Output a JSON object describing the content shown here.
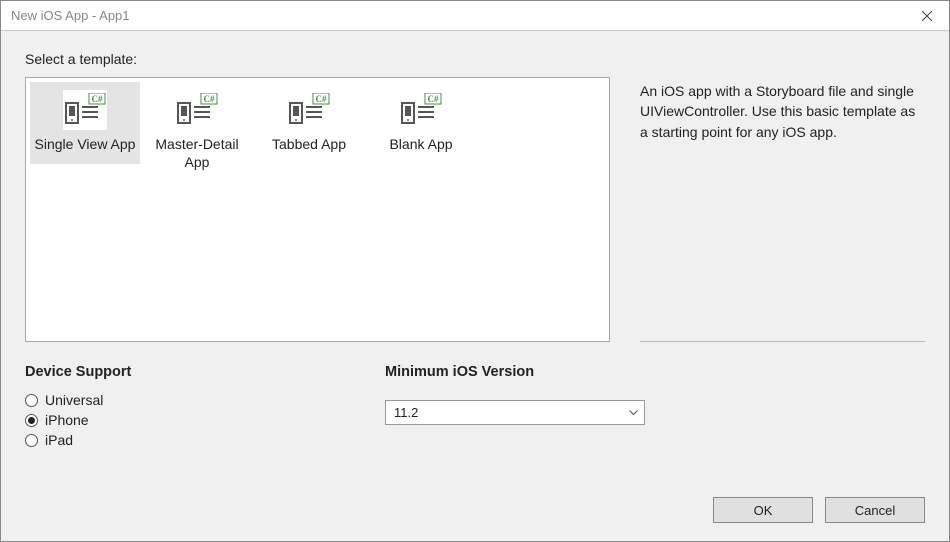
{
  "window": {
    "title": "New iOS App - App1"
  },
  "header": {
    "select_template": "Select a template:"
  },
  "templates": [
    {
      "id": "single-view",
      "label": "Single View App",
      "selected": true
    },
    {
      "id": "master-detail",
      "label": "Master-Detail App",
      "selected": false
    },
    {
      "id": "tabbed",
      "label": "Tabbed App",
      "selected": false
    },
    {
      "id": "blank",
      "label": "Blank App",
      "selected": false
    }
  ],
  "description": "An iOS app with a Storyboard file and single UIViewController. Use this basic template as a starting point for any iOS app.",
  "options": {
    "device_support": {
      "heading": "Device Support",
      "choices": [
        {
          "label": "Universal",
          "checked": false
        },
        {
          "label": "iPhone",
          "checked": true
        },
        {
          "label": "iPad",
          "checked": false
        }
      ]
    },
    "min_ios": {
      "heading": "Minimum iOS Version",
      "value": "11.2"
    }
  },
  "buttons": {
    "ok": "OK",
    "cancel": "Cancel"
  }
}
